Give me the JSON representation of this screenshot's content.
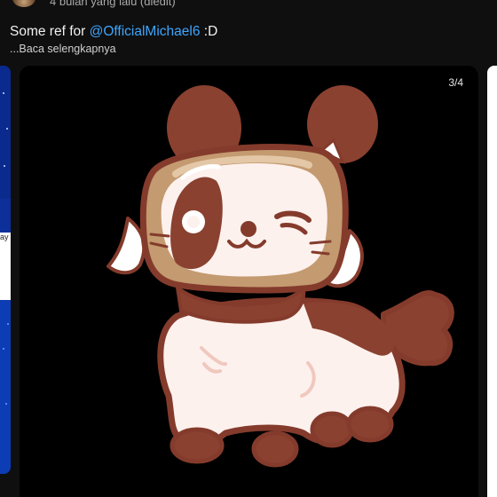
{
  "post": {
    "timestamp": "4 bulan yang lalu (diedit)",
    "text_prefix": "Some ref for ",
    "mention": "@OfficialMichael6",
    "text_suffix": " :D",
    "read_more": "...Baca selengkapnya"
  },
  "carousel": {
    "counter": "3/4",
    "current_index": 3,
    "total": 4,
    "prev_slide_text": "ay"
  },
  "colors": {
    "background": "#0f0f0f",
    "mention": "#3ea6ff",
    "art_outline": "#843b2c",
    "art_fur_brown": "#8a4130",
    "art_fur_cream": "#fdf1ee",
    "art_box": "#c49a70"
  }
}
